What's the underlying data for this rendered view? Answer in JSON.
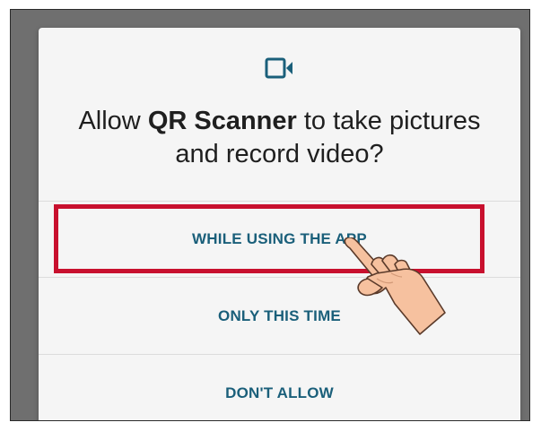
{
  "dialog": {
    "icon": "video-camera-icon",
    "title_prefix": "Allow ",
    "app_name": "QR Scanner",
    "title_suffix": " to take pictures and record video?",
    "options": [
      {
        "label": "WHILE USING THE APP",
        "highlighted": true
      },
      {
        "label": "ONLY THIS TIME",
        "highlighted": false
      },
      {
        "label": "DON'T ALLOW",
        "highlighted": false
      }
    ]
  },
  "overlay": {
    "pointer": "pointing-hand-icon"
  },
  "colors": {
    "accent": "#1a5f7a",
    "highlight": "#c8102e",
    "scrim": "#6f6f6f",
    "dialog_bg": "#f5f5f5",
    "hand_skin": "#f6c19f"
  }
}
